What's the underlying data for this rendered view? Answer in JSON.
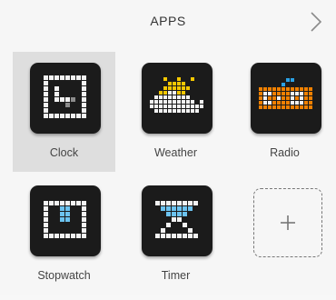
{
  "header": {
    "title": "APPS",
    "next_icon": "chevron-right-icon"
  },
  "apps": [
    {
      "label": "Clock",
      "icon": "clock-icon",
      "selected": true
    },
    {
      "label": "Weather",
      "icon": "weather-icon",
      "selected": false
    },
    {
      "label": "Radio",
      "icon": "radio-icon",
      "selected": false
    },
    {
      "label": "Stopwatch",
      "icon": "stopwatch-icon",
      "selected": false
    },
    {
      "label": "Timer",
      "icon": "timer-icon",
      "selected": false
    }
  ],
  "add_button": {
    "icon": "plus-icon"
  },
  "colors": {
    "background": "#f6f6f6",
    "selected_tile": "#dedede",
    "icon_background": "#1b1b1b",
    "pixel_white": "#f2f2f2",
    "pixel_grey": "#8c8c8c",
    "weather_yellow": "#f5c800",
    "radio_orange": "#f08000",
    "radio_blue": "#2aa2e6",
    "timer_blue": "#6cc3f0"
  }
}
